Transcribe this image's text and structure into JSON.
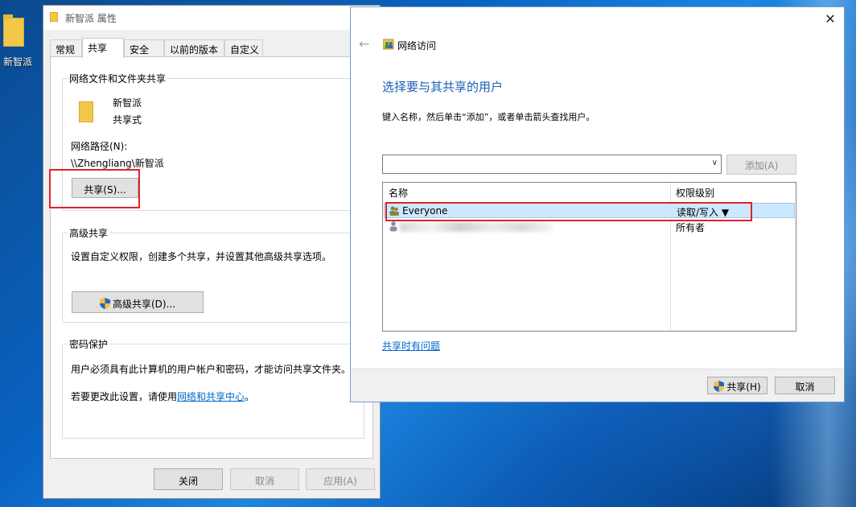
{
  "desktop": {
    "icon_label": "新智派"
  },
  "properties": {
    "title": "新智派 属性",
    "tabs": [
      "常规",
      "共享",
      "安全",
      "以前的版本",
      "自定义"
    ],
    "sharing_group": {
      "title": "网络文件和文件夹共享",
      "folder_name": "新智派",
      "folder_state": "共享式",
      "path_label": "网络路径(N):",
      "path_value": "\\\\Zhengliang\\新智派",
      "share_button": "共享(S)..."
    },
    "advanced_group": {
      "title": "高级共享",
      "description": "设置自定义权限，创建多个共享，并设置其他高级共享选项。",
      "button": "高级共享(D)..."
    },
    "password_group": {
      "title": "密码保护",
      "description": "用户必须具有此计算机的用户帐户和密码，才能访问共享文件夹。",
      "change_prefix": "若要更改此设置，请使用",
      "change_link": "网络和共享中心",
      "change_suffix": "。"
    },
    "buttons": {
      "close": "关闭",
      "cancel": "取消",
      "apply": "应用(A)"
    }
  },
  "network_access": {
    "nav_title": "网络访问",
    "heading": "选择要与其共享的用户",
    "instruction": "键入名称，然后单击“添加”，或者单击箭头查找用户。",
    "add_button": "添加(A)",
    "columns": {
      "name": "名称",
      "permission": "权限级别"
    },
    "rows": [
      {
        "name": "Everyone",
        "permission": "读取/写入 ▼"
      },
      {
        "name": "",
        "permission": "所有者"
      }
    ],
    "help_link": "共享时有问题",
    "share_button": "共享(H)",
    "cancel_button": "取消"
  }
}
